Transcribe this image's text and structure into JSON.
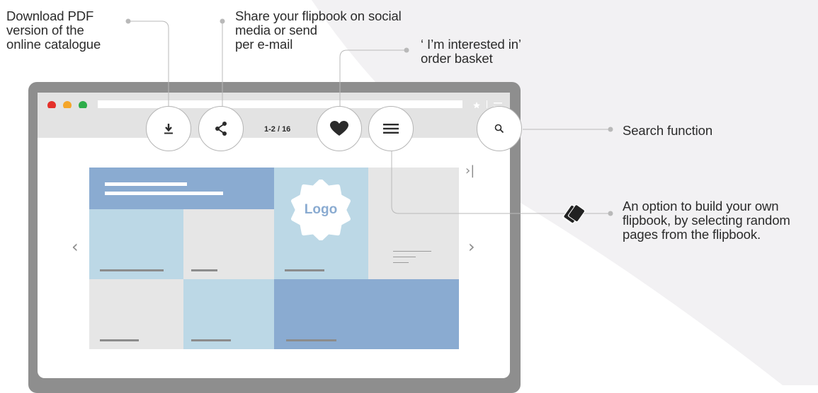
{
  "annotations": {
    "download_pdf": "Download PDF\nversion of the\nonline catalogue",
    "share": "Share your flipbook on social\nmedia or send\nper e-mail",
    "interested": "‘ I’m interested in’\norder basket",
    "search": "Search function",
    "build_flipbook": "An option to build your own\nflipbook, by selecting random\npages from the flipbook."
  },
  "toolbar": {
    "page_indicator": "1-2 / 16"
  },
  "catalogue": {
    "logo_text": "Logo"
  },
  "icons": {
    "download": "download-icon",
    "share": "share-icon",
    "heart": "heart-icon",
    "menu": "menu-icon",
    "search": "search-icon",
    "star": "star-icon",
    "cards": "cards-icon",
    "prev": "chevron-left-icon",
    "next": "chevron-right-icon",
    "last": "skip-to-last-icon"
  },
  "colors": {
    "blue_dark": "#8aabd1",
    "blue_light": "#bcd8e6",
    "grey_light": "#e6e6e6",
    "frame": "#8e8e8e",
    "dot_red": "#e4312b",
    "dot_orange": "#f4a62a",
    "dot_green": "#2dad4a"
  }
}
